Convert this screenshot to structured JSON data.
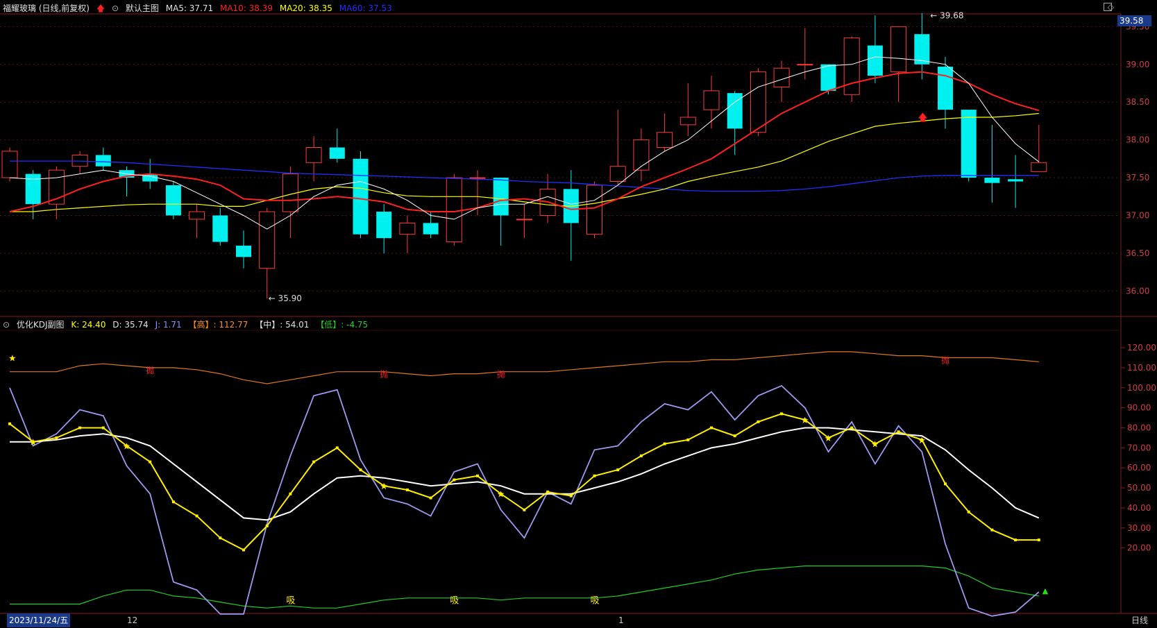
{
  "main_header": {
    "stock": "福耀玻璃 (日线,前复权)",
    "chart_name": "默认主图",
    "ma5": "MA5: 37.71",
    "ma10": "MA10: 38.39",
    "ma20": "MA20: 38.35",
    "ma60": "MA60: 37.53",
    "colors": {
      "ma5": "#ffffff",
      "ma10": "#ff2020",
      "ma20": "#ffff00",
      "ma60": "#2030ff"
    }
  },
  "sub_header": {
    "name": "优化KDJ副图",
    "k": "K: 24.40",
    "d": "D: 35.74",
    "j": "J: 1.71",
    "high": "【高】: 112.77",
    "mid": "【中】: 54.01",
    "low": "【低】: -4.75"
  },
  "current_price": "39.58",
  "annotations": {
    "max_label": "39.68",
    "min_label": "35.90"
  },
  "bottom_bar": {
    "date": "2023/11/24/五",
    "month1": "12",
    "month2": "1",
    "period": "日线"
  },
  "signal_labels": {
    "sell": "抛",
    "buy": "吸"
  },
  "chart_data": {
    "type": "candlestick",
    "ylim": [
      35.7,
      39.65
    ],
    "y_ticks": [
      39.5,
      39.0,
      38.5,
      38.0,
      37.5,
      37.0,
      36.5,
      36.0
    ],
    "candles": [
      {
        "o": 37.5,
        "c": 37.85,
        "h": 37.9,
        "l": 37.45
      },
      {
        "o": 37.55,
        "c": 37.15,
        "h": 37.6,
        "l": 36.95
      },
      {
        "o": 37.15,
        "c": 37.6,
        "h": 37.65,
        "l": 36.95
      },
      {
        "o": 37.65,
        "c": 37.8,
        "h": 37.85,
        "l": 37.55
      },
      {
        "o": 37.8,
        "c": 37.65,
        "h": 37.9,
        "l": 37.6
      },
      {
        "o": 37.6,
        "c": 37.5,
        "h": 37.65,
        "l": 37.25
      },
      {
        "o": 37.55,
        "c": 37.45,
        "h": 37.75,
        "l": 37.35
      },
      {
        "o": 37.4,
        "c": 37.0,
        "h": 37.45,
        "l": 36.95
      },
      {
        "o": 36.95,
        "c": 37.05,
        "h": 37.15,
        "l": 36.7
      },
      {
        "o": 37.0,
        "c": 36.65,
        "h": 37.1,
        "l": 36.6
      },
      {
        "o": 36.6,
        "c": 36.45,
        "h": 36.8,
        "l": 36.3
      },
      {
        "o": 36.3,
        "c": 37.05,
        "h": 37.1,
        "l": 35.9
      },
      {
        "o": 37.05,
        "c": 37.55,
        "h": 37.65,
        "l": 36.7
      },
      {
        "o": 37.7,
        "c": 37.9,
        "h": 38.05,
        "l": 37.45
      },
      {
        "o": 37.9,
        "c": 37.75,
        "h": 38.15,
        "l": 37.7
      },
      {
        "o": 37.75,
        "c": 36.75,
        "h": 37.85,
        "l": 36.7
      },
      {
        "o": 37.05,
        "c": 36.7,
        "h": 37.15,
        "l": 36.5
      },
      {
        "o": 36.75,
        "c": 36.9,
        "h": 37.0,
        "l": 36.5
      },
      {
        "o": 36.9,
        "c": 36.75,
        "h": 37.05,
        "l": 36.7
      },
      {
        "o": 36.65,
        "c": 37.5,
        "h": 37.55,
        "l": 36.6
      },
      {
        "o": 37.5,
        "c": 37.5,
        "h": 37.6,
        "l": 37.0
      },
      {
        "o": 37.5,
        "c": 37.0,
        "h": 37.5,
        "l": 36.6
      },
      {
        "o": 36.95,
        "c": 36.95,
        "h": 37.15,
        "l": 36.7
      },
      {
        "o": 37.0,
        "c": 37.35,
        "h": 37.55,
        "l": 36.9
      },
      {
        "o": 37.35,
        "c": 36.9,
        "h": 37.6,
        "l": 36.4
      },
      {
        "o": 36.75,
        "c": 37.4,
        "h": 37.45,
        "l": 36.7
      },
      {
        "o": 37.45,
        "c": 37.65,
        "h": 38.4,
        "l": 37.4
      },
      {
        "o": 37.6,
        "c": 38.0,
        "h": 38.15,
        "l": 37.45
      },
      {
        "o": 37.9,
        "c": 38.1,
        "h": 38.35,
        "l": 37.85
      },
      {
        "o": 38.2,
        "c": 38.3,
        "h": 38.75,
        "l": 38.05
      },
      {
        "o": 38.4,
        "c": 38.65,
        "h": 38.85,
        "l": 38.15
      },
      {
        "o": 38.62,
        "c": 38.15,
        "h": 38.65,
        "l": 37.8
      },
      {
        "o": 38.1,
        "c": 38.9,
        "h": 38.95,
        "l": 38.05
      },
      {
        "o": 38.7,
        "c": 38.95,
        "h": 39.05,
        "l": 38.5
      },
      {
        "o": 39.0,
        "c": 39.0,
        "h": 39.48,
        "l": 38.8
      },
      {
        "o": 39.0,
        "c": 38.65,
        "h": 39.0,
        "l": 38.6
      },
      {
        "o": 38.6,
        "c": 39.35,
        "h": 39.37,
        "l": 38.5
      },
      {
        "o": 39.25,
        "c": 38.85,
        "h": 39.65,
        "l": 38.75
      },
      {
        "o": 38.9,
        "c": 39.5,
        "h": 39.5,
        "l": 38.5
      },
      {
        "o": 39.4,
        "c": 39.0,
        "h": 39.68,
        "l": 38.8
      },
      {
        "o": 38.97,
        "c": 38.4,
        "h": 39.1,
        "l": 38.15
      },
      {
        "o": 38.4,
        "c": 37.5,
        "h": 38.4,
        "l": 37.45
      },
      {
        "o": 37.5,
        "c": 37.43,
        "h": 38.2,
        "l": 37.17
      },
      {
        "o": 37.48,
        "c": 37.45,
        "h": 37.8,
        "l": 37.1
      },
      {
        "o": 37.58,
        "c": 37.7,
        "h": 38.2,
        "l": 37.58
      }
    ],
    "ma5": [
      37.5,
      37.48,
      37.5,
      37.55,
      37.6,
      37.55,
      37.52,
      37.45,
      37.3,
      37.15,
      37.0,
      36.82,
      37.0,
      37.25,
      37.4,
      37.45,
      37.35,
      37.2,
      37.0,
      36.95,
      37.1,
      37.15,
      37.15,
      37.25,
      37.15,
      37.2,
      37.4,
      37.65,
      37.85,
      38.0,
      38.25,
      38.5,
      38.7,
      38.8,
      38.9,
      38.98,
      39.0,
      39.1,
      39.08,
      39.05,
      39.0,
      38.75,
      38.3,
      37.95,
      37.71
    ],
    "ma10": [
      37.05,
      37.12,
      37.22,
      37.35,
      37.45,
      37.52,
      37.55,
      37.52,
      37.48,
      37.4,
      37.22,
      37.2,
      37.2,
      37.22,
      37.25,
      37.22,
      37.18,
      37.08,
      37.05,
      37.05,
      37.1,
      37.2,
      37.22,
      37.18,
      37.08,
      37.1,
      37.22,
      37.38,
      37.5,
      37.62,
      37.75,
      37.95,
      38.15,
      38.35,
      38.5,
      38.65,
      38.75,
      38.82,
      38.88,
      38.9,
      38.85,
      38.75,
      38.6,
      38.48,
      38.39
    ],
    "ma20": [
      37.05,
      37.05,
      37.08,
      37.1,
      37.12,
      37.14,
      37.15,
      37.15,
      37.15,
      37.12,
      37.12,
      37.2,
      37.28,
      37.35,
      37.38,
      37.36,
      37.3,
      37.26,
      37.25,
      37.25,
      37.25,
      37.22,
      37.18,
      37.14,
      37.12,
      37.16,
      37.22,
      37.28,
      37.35,
      37.45,
      37.52,
      37.58,
      37.64,
      37.72,
      37.85,
      37.98,
      38.08,
      38.18,
      38.22,
      38.25,
      38.28,
      38.3,
      38.3,
      38.32,
      38.35
    ],
    "ma60": [
      37.72,
      37.72,
      37.72,
      37.72,
      37.71,
      37.7,
      37.68,
      37.66,
      37.64,
      37.62,
      37.6,
      37.58,
      37.56,
      37.55,
      37.54,
      37.53,
      37.52,
      37.51,
      37.5,
      37.49,
      37.48,
      37.47,
      37.45,
      37.44,
      37.43,
      37.41,
      37.39,
      37.37,
      37.35,
      37.33,
      37.32,
      37.32,
      37.32,
      37.33,
      37.35,
      37.38,
      37.42,
      37.46,
      37.5,
      37.52,
      37.53,
      37.53,
      37.53,
      37.53,
      37.53
    ],
    "kdj": {
      "ylim": [
        -12,
        128
      ],
      "y_ticks": [
        120.0,
        110.0,
        100.0,
        90.0,
        80.0,
        70.0,
        60.0,
        50.0,
        40.0,
        30.0,
        20.0
      ],
      "K": [
        82,
        73,
        75,
        80,
        80,
        71,
        63,
        43,
        36,
        25,
        19,
        31,
        47,
        63,
        70,
        59,
        51,
        49,
        45,
        54,
        56,
        47,
        39,
        48,
        46,
        56,
        59,
        66,
        72,
        74,
        80,
        76,
        83,
        87,
        84,
        75,
        80,
        72,
        78,
        74,
        52,
        38,
        29,
        24,
        24
      ],
      "D": [
        73,
        73,
        74,
        76,
        77,
        75,
        71,
        62,
        53,
        44,
        35,
        34,
        38,
        47,
        55,
        56,
        55,
        53,
        51,
        52,
        53,
        51,
        47,
        47,
        47,
        50,
        53,
        57,
        62,
        66,
        70,
        72,
        75,
        78,
        80,
        80,
        79,
        78,
        77,
        76,
        69,
        59,
        50,
        40,
        35
      ],
      "J": [
        100,
        71,
        77,
        89,
        86,
        61,
        47,
        3,
        -1,
        -13,
        -13,
        32,
        66,
        96,
        99,
        64,
        45,
        42,
        36,
        58,
        62,
        39,
        25,
        48,
        42,
        69,
        71,
        83,
        92,
        89,
        98,
        84,
        96,
        101,
        90,
        68,
        83,
        62,
        81,
        68,
        22,
        -10,
        -14,
        -12,
        -2
      ],
      "HIGH": [
        108,
        108,
        108,
        111,
        112,
        111,
        110,
        110,
        109,
        107,
        104,
        102,
        104,
        106,
        108,
        108,
        108,
        107,
        106,
        107,
        107,
        108,
        108,
        108,
        109,
        110,
        111,
        112,
        113,
        113,
        114,
        114,
        115,
        116,
        117,
        118,
        118,
        117,
        116,
        116,
        115,
        115,
        115,
        114,
        113
      ],
      "LOW": [
        -8,
        -8,
        -8,
        -8,
        -4,
        -1,
        -1,
        -4,
        -5,
        -7,
        -9,
        -10,
        -9,
        -10,
        -10,
        -8,
        -6,
        -5,
        -5,
        -5,
        -5,
        -6,
        -5,
        -5,
        -5,
        -5,
        -4,
        -2,
        0,
        2,
        4,
        7,
        9,
        10,
        11,
        11,
        11,
        11,
        11,
        11,
        10,
        6,
        0,
        -2,
        -4
      ]
    }
  }
}
